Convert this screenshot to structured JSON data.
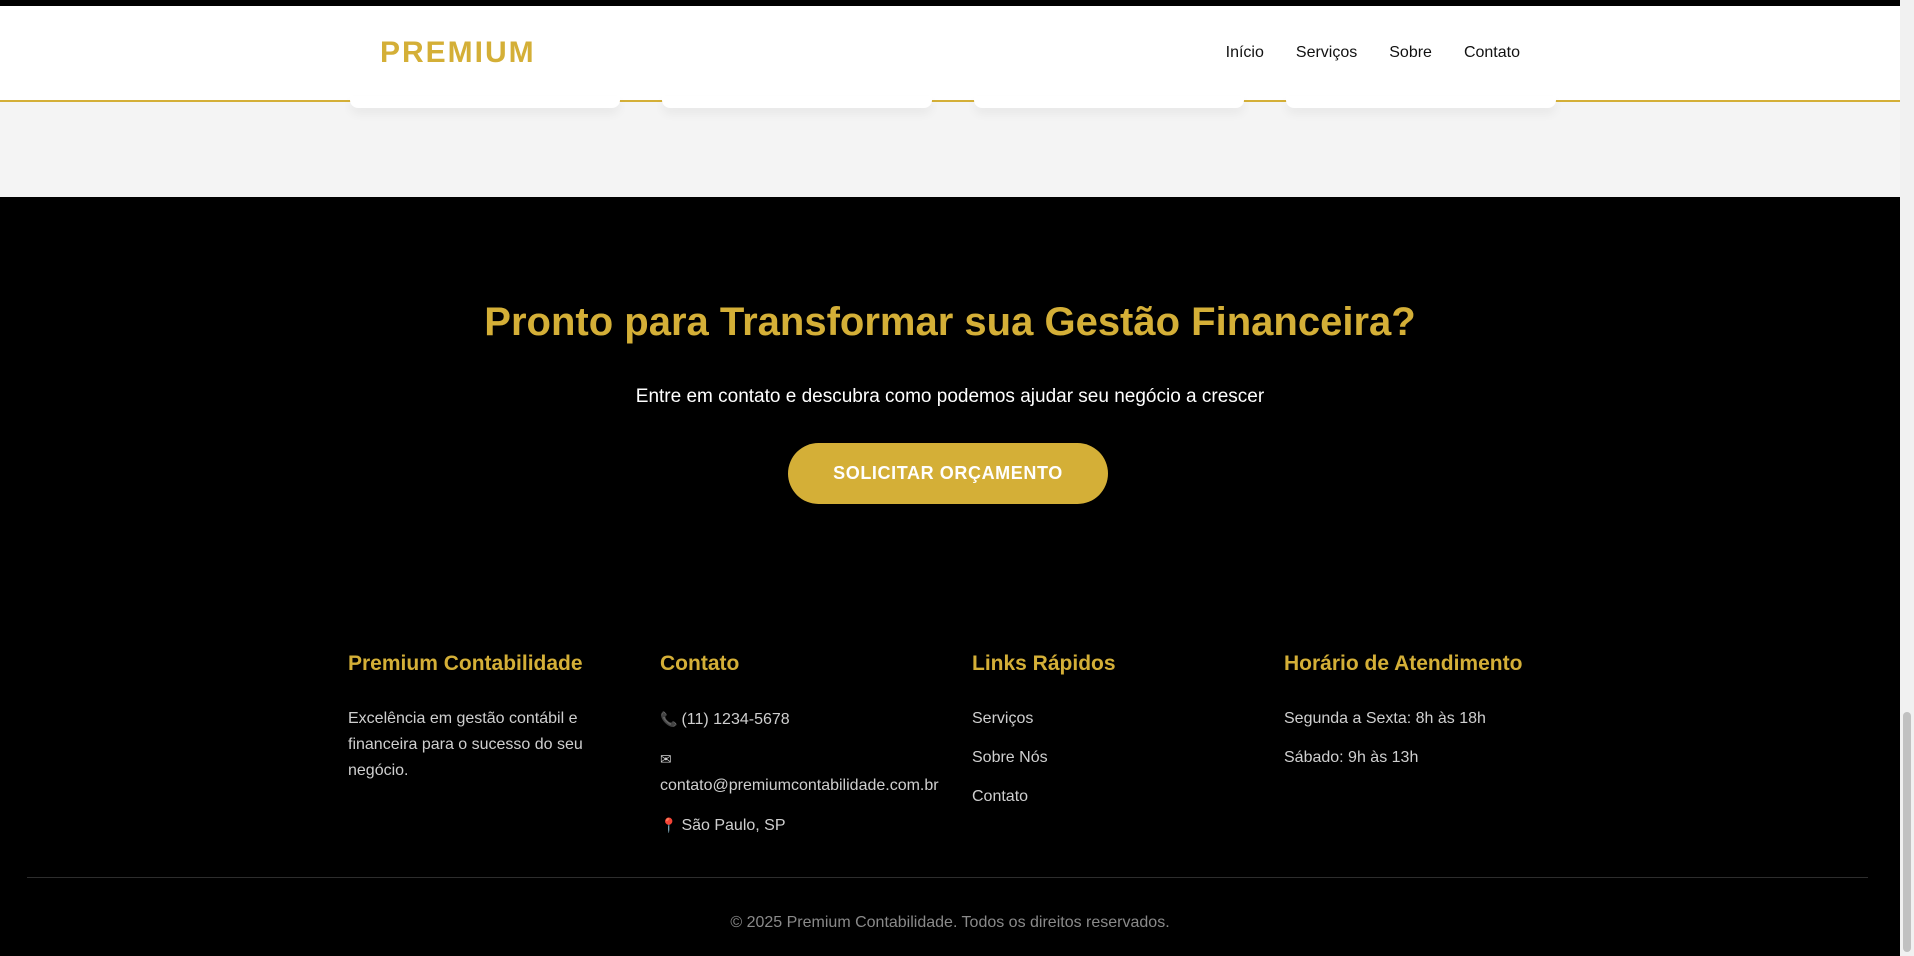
{
  "header": {
    "brand": "PREMIUM",
    "nav": [
      "Início",
      "Serviços",
      "Sobre",
      "Contato"
    ]
  },
  "cta": {
    "title": "Pronto para Transformar sua Gestão Financeira?",
    "text": "Entre em contato e descubra como podemos ajudar seu negócio a crescer",
    "button_label": "SOLICITAR ORÇAMENTO"
  },
  "footer": {
    "about": {
      "title": "Premium Contabilidade",
      "text": "Excelência em gestão contábil e financeira para o sucesso do seu negócio."
    },
    "contact": {
      "title": "Contato",
      "phone": "(11) 1234-5678",
      "email": "contato@premiumcontabilidade.com.br",
      "location": "São Paulo, SP"
    },
    "links": {
      "title": "Links Rápidos",
      "items": [
        "Serviços",
        "Sobre Nós",
        "Contato"
      ]
    },
    "hours": {
      "title": "Horário de Atendimento",
      "weekdays": "Segunda a Sexta: 8h às 18h",
      "saturday": "Sábado: 9h às 13h"
    },
    "copyright": "© 2025 Premium Contabilidade. Todos os direitos reservados."
  },
  "colors": {
    "accent": "#d4af37",
    "background": "#000000",
    "header_background": "#ffffff"
  }
}
